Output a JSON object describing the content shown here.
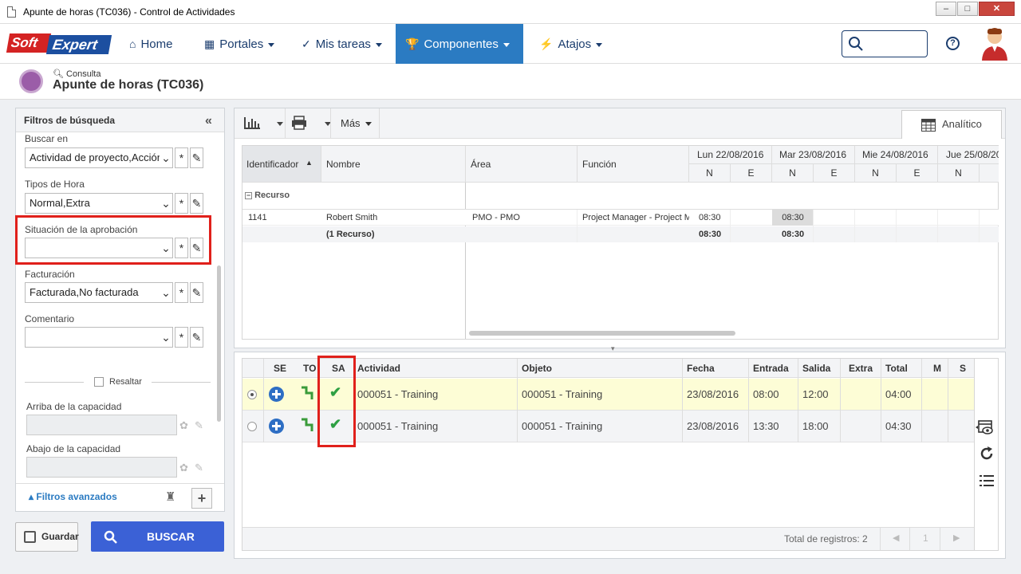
{
  "window": {
    "title": "Apunte de horas (TC036) - Control de Actividades"
  },
  "brand": {
    "soft": "Soft",
    "expert": "Expert"
  },
  "nav": {
    "home": "Home",
    "portales": "Portales",
    "mis_tareas": "Mis tareas",
    "componentes": "Componentes",
    "atajos": "Atajos"
  },
  "header": {
    "sub": "Consulta",
    "title": "Apunte de horas (TC036)"
  },
  "filters": {
    "title": "Filtros de búsqueda",
    "buscar_en": {
      "label": "Buscar en",
      "value": "Actividad de proyecto,Acción"
    },
    "tipos_hora": {
      "label": "Tipos de Hora",
      "value": "Normal,Extra"
    },
    "situacion": {
      "label": "Situación de la aprobación",
      "value": ""
    },
    "facturacion": {
      "label": "Facturación",
      "value": "Facturada,No facturada"
    },
    "comentario": {
      "label": "Comentario",
      "value": ""
    },
    "resaltar": "Resaltar",
    "arriba": "Arriba de la capacidad",
    "abajo": "Abajo de la capacidad",
    "avanzados": "Filtros avanzados"
  },
  "buttons": {
    "guardar": "Guardar",
    "buscar": "BUSCAR"
  },
  "toolbar": {
    "mas": "Más",
    "analitico": "Analítico"
  },
  "grid1": {
    "headers": {
      "identificador": "Identificador",
      "nombre": "Nombre",
      "area": "Área",
      "funcion": "Función"
    },
    "days": [
      {
        "label": "Lun 22/08/2016",
        "n": "N",
        "e": "E"
      },
      {
        "label": "Mar 23/08/2016",
        "n": "N",
        "e": "E"
      },
      {
        "label": "Mie 24/08/2016",
        "n": "N",
        "e": "E"
      },
      {
        "label": "Jue 25/08/20",
        "n": "N"
      }
    ],
    "group": "Recurso",
    "row": {
      "id": "1141",
      "nombre": "Robert Smith",
      "area": "PMO - PMO",
      "funcion": "Project Manager - Project M",
      "d1n": "08:30",
      "d2n": "08:30"
    },
    "total": {
      "label": "(1 Recurso)",
      "d1n": "08:30",
      "d2n": "08:30"
    }
  },
  "grid2": {
    "headers": {
      "se": "SE",
      "to": "TO",
      "sa": "SA",
      "actividad": "Actividad",
      "objeto": "Objeto",
      "fecha": "Fecha",
      "entrada": "Entrada",
      "salida": "Salida",
      "extra": "Extra",
      "total": "Total",
      "m": "M",
      "s": "S"
    },
    "rows": [
      {
        "actividad": "000051 - Training",
        "objeto": "000051 - Training",
        "fecha": "23/08/2016",
        "entrada": "08:00",
        "salida": "12:00",
        "total": "04:00",
        "selected": true
      },
      {
        "actividad": "000051 - Training",
        "objeto": "000051 - Training",
        "fecha": "23/08/2016",
        "entrada": "13:30",
        "salida": "18:00",
        "total": "04:30",
        "selected": false
      }
    ],
    "footer": {
      "total": "Total de registros: 2",
      "page": "1"
    }
  },
  "colors": {
    "accent": "#2b7bc2",
    "buscar": "#3b61d6",
    "highlight": "#e0201b",
    "selected_row": "#fdfdd6"
  }
}
